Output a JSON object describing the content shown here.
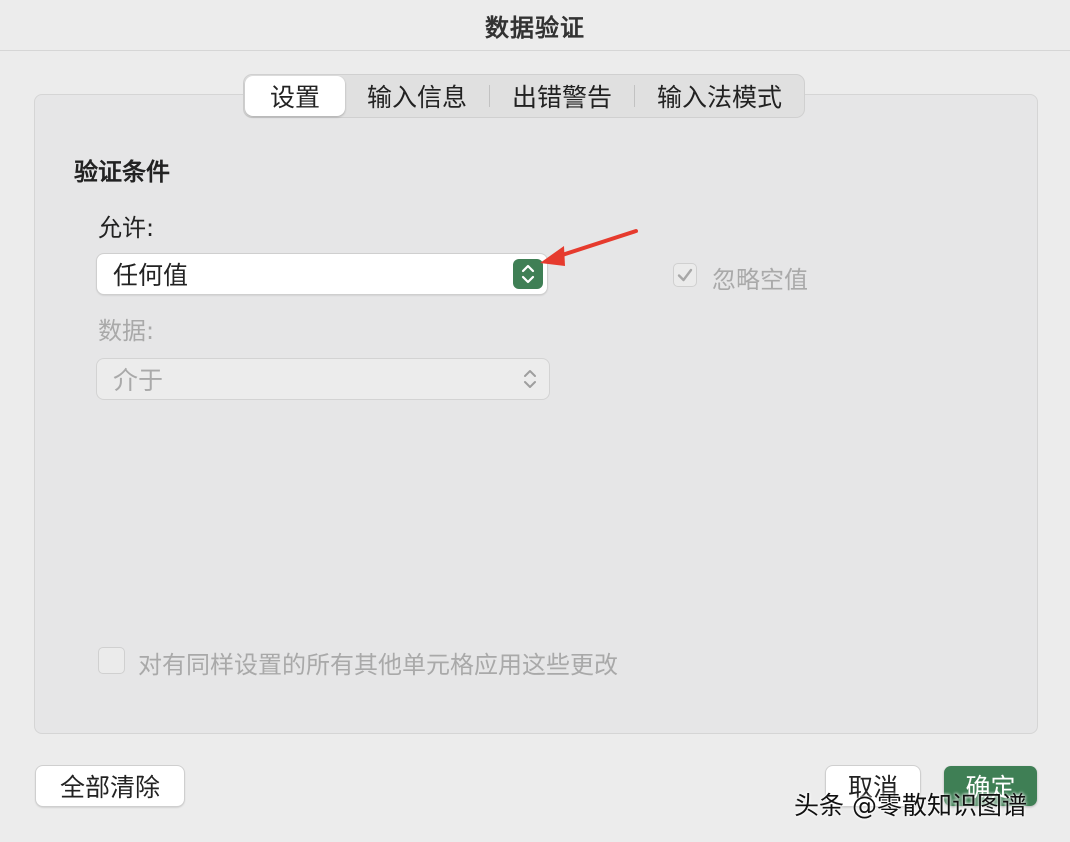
{
  "window": {
    "title": "数据验证"
  },
  "tabs": [
    {
      "label": "设置",
      "active": true
    },
    {
      "label": "输入信息"
    },
    {
      "label": "出错警告"
    },
    {
      "label": "输入法模式"
    }
  ],
  "settings": {
    "section_title": "验证条件",
    "allow_label": "允许:",
    "allow_value": "任何值",
    "ignore_blank_label": "忽略空值",
    "ignore_blank_checked": true,
    "data_label": "数据:",
    "data_value": "介于",
    "apply_all_label": "对有同样设置的所有其他单元格应用这些更改",
    "apply_all_checked": false
  },
  "buttons": {
    "clear_all": "全部清除",
    "cancel": "取消",
    "ok": "确定"
  },
  "watermark": "头条 @零散知识图谱",
  "colors": {
    "accent": "#3f7f55",
    "annotation_arrow": "#e63b2e"
  }
}
